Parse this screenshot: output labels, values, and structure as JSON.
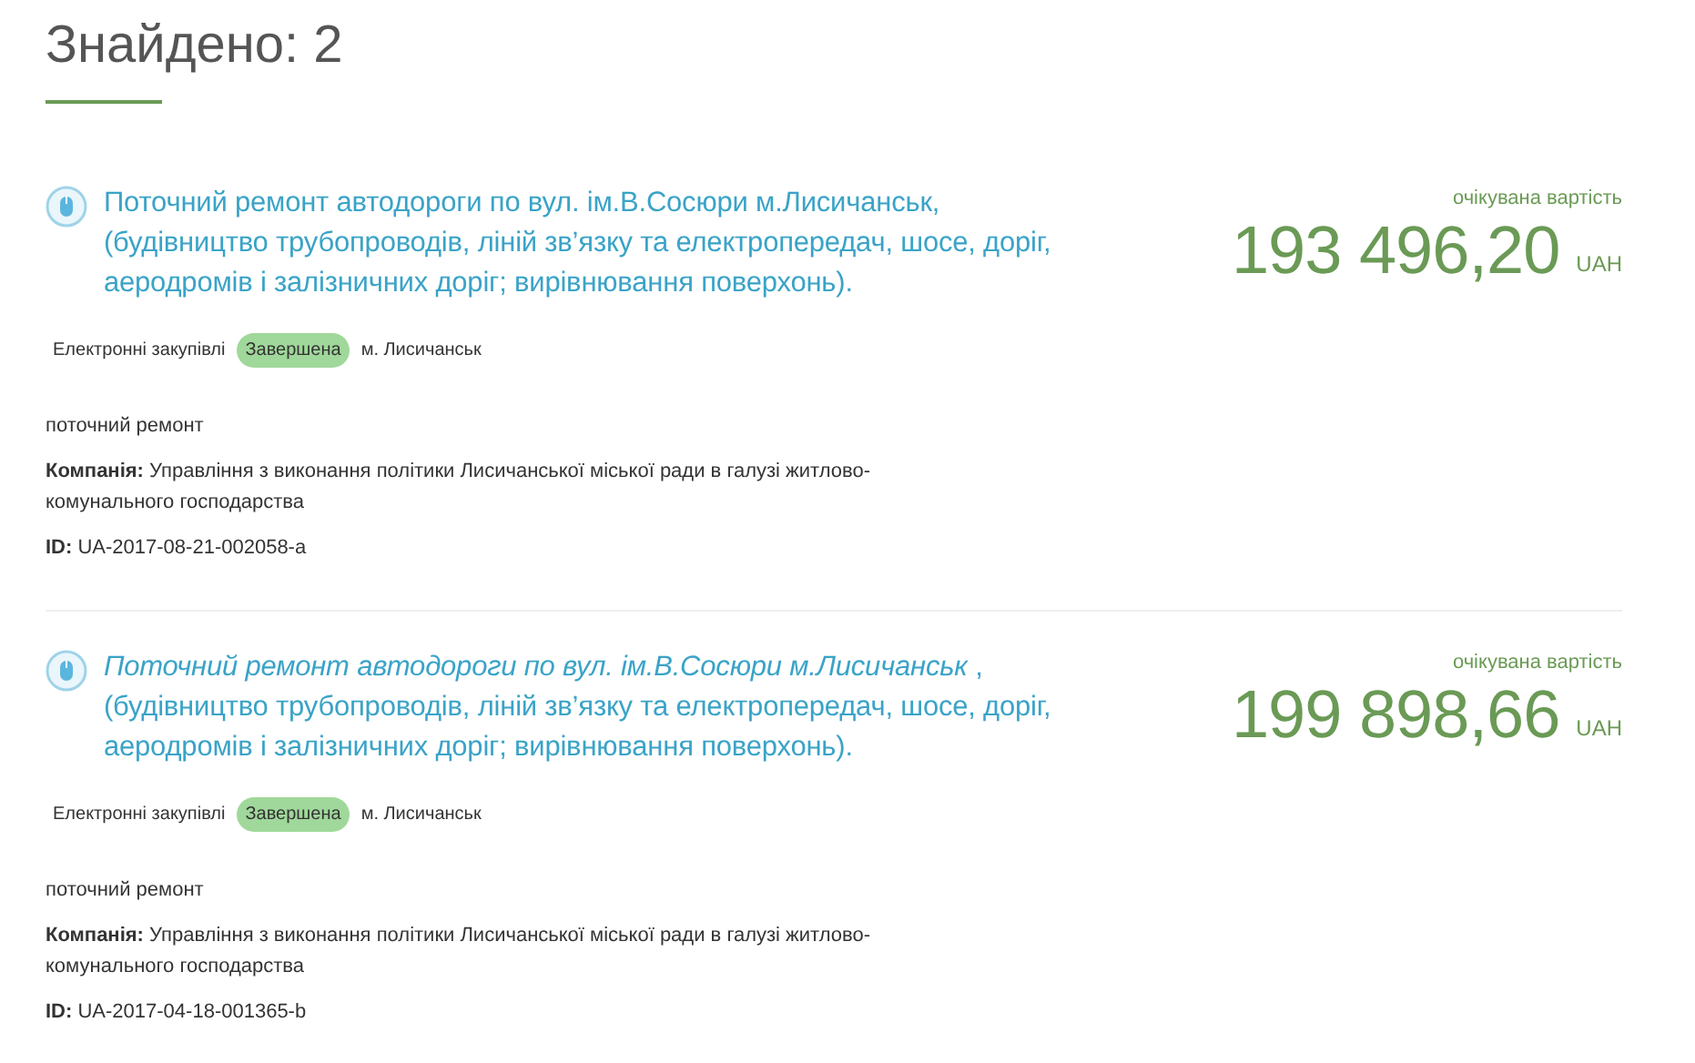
{
  "heading": "Знайдено: 2",
  "results": [
    {
      "title": "Поточний ремонт автодороги по вул. ім.В.Сосюри м.Лисичанськ, (будівництво трубопроводів, ліній зв’язку та електропередач, шосе, доріг, аеродромів і залізничних доріг; вирівнювання поверхонь).",
      "price_label": "очікувана вартість",
      "amount": "193 496,20",
      "currency": "UAH",
      "procedure": "Електронні закупівлі",
      "status": "Завершена",
      "city": "м. Лисичанськ",
      "description": "поточний ремонт",
      "company": "**Компанія:** Управління з виконання політики Лисичанської міської ради в галузі житлово-комунального господарства",
      "id": "**ID:** UA-2017-08-21-002058-a"
    },
    {
      "title": "*Поточний ремонт автодороги по вул. ім.В.Сосюри м.Лисичанськ* , (будівництво трубопроводів, ліній зв’язку та електропередач, шосе, доріг, аеродромів і залізничних доріг; вирівнювання поверхонь).",
      "price_label": "очікувана вартість",
      "amount": "199 898,66",
      "currency": "UAH",
      "procedure": "Електронні закупівлі",
      "status": "Завершена",
      "city": "м. Лисичанськ",
      "description": "поточний ремонт",
      "company": "**Компанія:** Управління з виконання політики Лисичанської міської ради в галузі житлово-комунального господарства",
      "id": "**ID:** UA-2017-04-18-001365-b"
    }
  ]
}
